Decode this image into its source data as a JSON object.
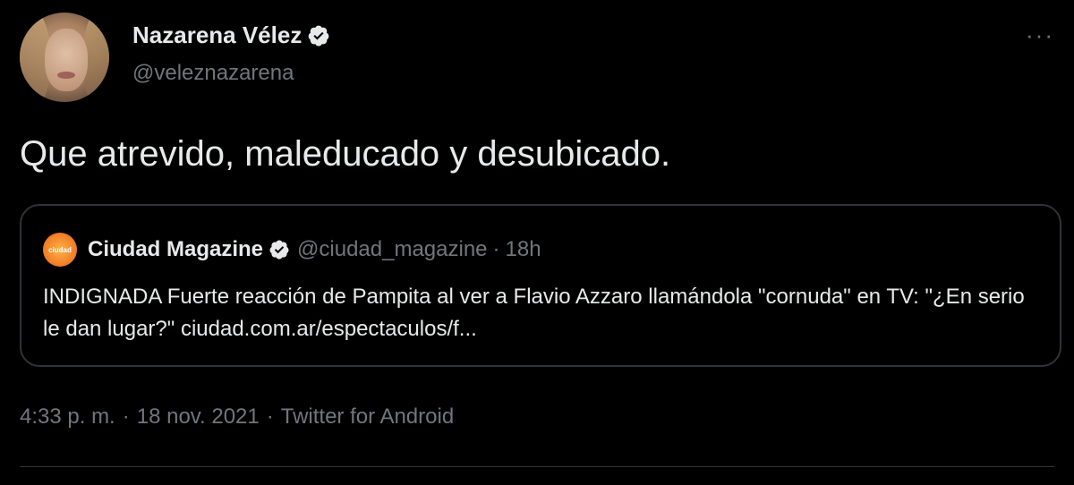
{
  "author": {
    "display_name": "Nazarena Vélez",
    "handle": "@veleznazarena",
    "verified": true
  },
  "more_label": "···",
  "tweet": {
    "text": "Que atrevido, maleducado y desubicado."
  },
  "quoted": {
    "avatar_text": "ciudad",
    "display_name": "Ciudad Magazine",
    "handle": "@ciudad_magazine",
    "separator": "·",
    "time": "18h",
    "body": "INDIGNADA Fuerte reacción de Pampita al ver a Flavio Azzaro llamándola \"cornuda\" en TV: \"¿En serio le dan lugar?\" ciudad.com.ar/espectaculos/f..."
  },
  "meta": {
    "time": "4:33 p. m.",
    "sep1": "·",
    "date": "18 nov. 2021",
    "sep2": "·",
    "source": "Twitter for Android"
  },
  "colors": {
    "background": "#000000",
    "text": "#e7e9ea",
    "secondary": "#71767b",
    "border": "#2f3336",
    "verified_badge": "#e7e9ea"
  }
}
